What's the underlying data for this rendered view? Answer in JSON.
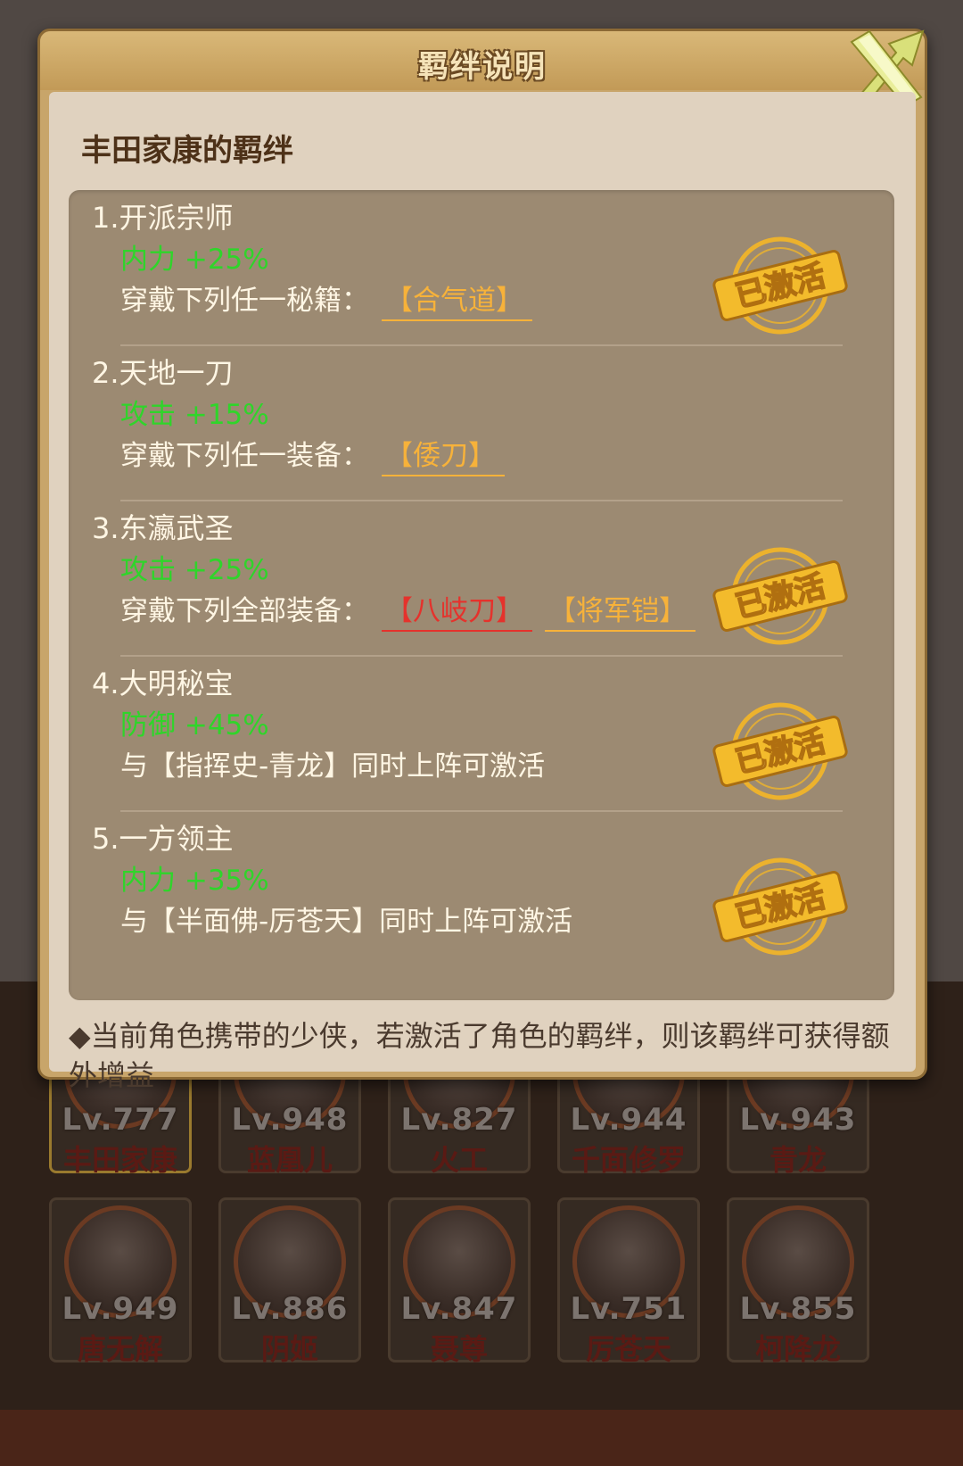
{
  "dialog": {
    "title": "羁绊说明",
    "hero_title": "丰田家康的羁绊",
    "close_icon": "close-x-icon"
  },
  "bonds": [
    {
      "name": "1.开派宗师",
      "bonus": "内力 +25%",
      "desc": "穿戴下列任一秘籍：",
      "items": [
        {
          "label": "【合气道】",
          "color": "#f7b23a"
        }
      ],
      "activated": true
    },
    {
      "name": "2.天地一刀",
      "bonus": "攻击 +15%",
      "desc": "穿戴下列任一装备：",
      "items": [
        {
          "label": "【倭刀】",
          "color": "#f7b23a"
        }
      ],
      "activated": false
    },
    {
      "name": "3.东瀛武圣",
      "bonus": "攻击 +25%",
      "desc": "穿戴下列全部装备：",
      "items": [
        {
          "label": "【八岐刀】",
          "color": "#e5322c"
        },
        {
          "label": "【将军铠】",
          "color": "#f7b23a"
        }
      ],
      "activated": true
    },
    {
      "name": "4.大明秘宝",
      "bonus": "防御 +45%",
      "desc": "与【指挥史-青龙】同时上阵可激活",
      "items": [],
      "activated": true
    },
    {
      "name": "5.一方领主",
      "bonus": "内力 +35%",
      "desc": "与【半面佛-厉苍天】同时上阵可激活",
      "items": [],
      "activated": true
    }
  ],
  "stamp_label": "已激活",
  "note": "◆当前角色携带的少侠，若激活了角色的羁绊，则该羁绊可获得额外增益",
  "heroes": [
    {
      "level": "Lv.777",
      "name": "丰田家康",
      "selected": true
    },
    {
      "level": "Lv.948",
      "name": "蓝凰儿",
      "selected": false
    },
    {
      "level": "Lv.827",
      "name": "火工",
      "selected": false
    },
    {
      "level": "Lv.944",
      "name": "千面修罗",
      "selected": false
    },
    {
      "level": "Lv.943",
      "name": "青龙",
      "selected": false
    },
    {
      "level": "Lv.949",
      "name": "唐无解",
      "selected": false
    },
    {
      "level": "Lv.886",
      "name": "阴姬",
      "selected": false
    },
    {
      "level": "Lv.847",
      "name": "聂尊",
      "selected": false
    },
    {
      "level": "Lv.751",
      "name": "厉苍天",
      "selected": false
    },
    {
      "level": "Lv.855",
      "name": "柯降龙",
      "selected": false
    }
  ],
  "colors": {
    "bonus_green": "#2fd52a",
    "item_orange": "#f7b23a",
    "item_red": "#e5322c",
    "stamp_gold": "#f0b429"
  }
}
